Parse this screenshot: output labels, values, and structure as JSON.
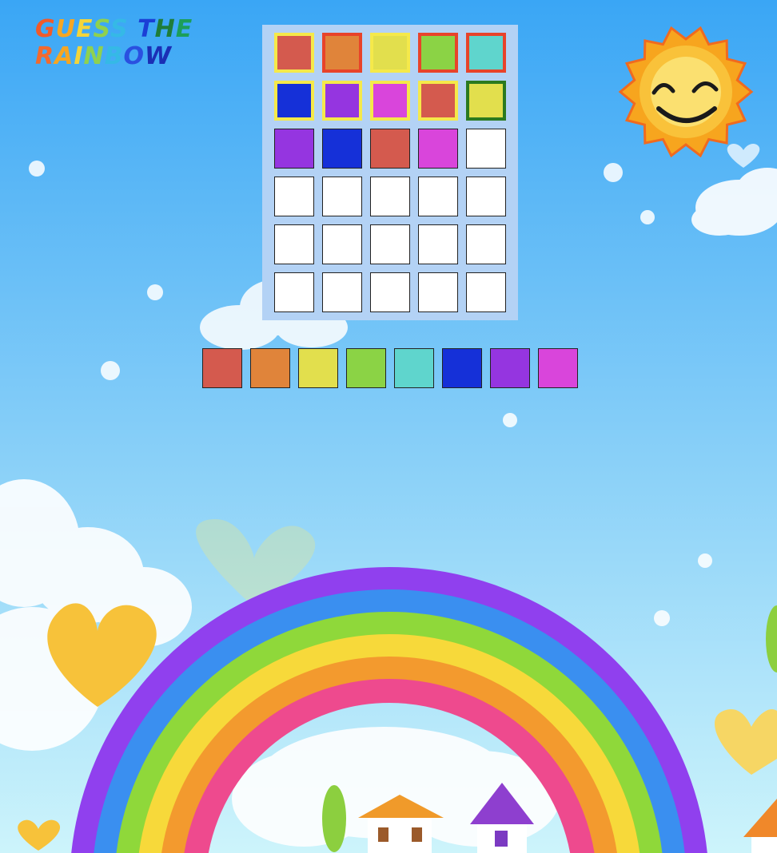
{
  "title": {
    "lines": [
      [
        {
          "ch": "G",
          "color": "#f05a2a"
        },
        {
          "ch": "U",
          "color": "#f5a623"
        },
        {
          "ch": "E",
          "color": "#f3d53b"
        },
        {
          "ch": "S",
          "color": "#8fd14f"
        },
        {
          "ch": "S",
          "color": "#35b9e6"
        },
        {
          "ch": " ",
          "color": "#ffffff"
        },
        {
          "ch": "T",
          "color": "#1b3fd6"
        },
        {
          "ch": "H",
          "color": "#1e7d3a"
        },
        {
          "ch": "E",
          "color": "#1c9e5a"
        }
      ],
      [
        {
          "ch": "R",
          "color": "#f26a2e"
        },
        {
          "ch": "A",
          "color": "#f5a623"
        },
        {
          "ch": "I",
          "color": "#f3d53b"
        },
        {
          "ch": "N",
          "color": "#8fd14f"
        },
        {
          "ch": "B",
          "color": "#35b9e6"
        },
        {
          "ch": "O",
          "color": "#2a50e0"
        },
        {
          "ch": "W",
          "color": "#1b2fb5"
        }
      ]
    ]
  },
  "board": {
    "rows": 6,
    "cols": 5,
    "guesses": [
      [
        "#d45a4e",
        "#e0843a",
        "#e2df4d",
        "#8bd345",
        "#5fd5cd"
      ],
      [
        "#1530d8",
        "#9535e0",
        "#d945db",
        "#d45a4e",
        "#e2df4d"
      ],
      [
        "#9535e0",
        "#1530d8",
        "#d45a4e",
        "#d945db",
        "#ffffff"
      ],
      [
        "#ffffff",
        "#ffffff",
        "#ffffff",
        "#ffffff",
        "#ffffff"
      ],
      [
        "#ffffff",
        "#ffffff",
        "#ffffff",
        "#ffffff",
        "#ffffff"
      ],
      [
        "#ffffff",
        "#ffffff",
        "#ffffff",
        "#ffffff",
        "#ffffff"
      ]
    ],
    "feedback": [
      [
        "present",
        "wrong",
        "present",
        "wrong",
        "wrong"
      ],
      [
        "present",
        "present",
        "present",
        "present",
        "correct"
      ],
      [
        "none",
        "none",
        "none",
        "none",
        "none"
      ],
      [
        "none",
        "none",
        "none",
        "none",
        "none"
      ],
      [
        "none",
        "none",
        "none",
        "none",
        "none"
      ],
      [
        "none",
        "none",
        "none",
        "none",
        "none"
      ]
    ],
    "feedback_colors": {
      "present": "#f5e94a",
      "wrong": "#e8432a",
      "correct": "#2b7a1f"
    }
  },
  "palette": [
    "#d45a4e",
    "#e0843a",
    "#e2df4d",
    "#8bd345",
    "#5fd5cd",
    "#1530d8",
    "#9535e0",
    "#d945db"
  ],
  "scene": {
    "sky_top": "#3aa6f5",
    "sky_bottom": "#cdf4fb",
    "rainbow_bands": [
      "#9040ee",
      "#3a8ff0",
      "#8fd83a",
      "#f7d93a",
      "#f39a2e",
      "#ee4a8e"
    ],
    "sun_color": "#f7a51e"
  }
}
